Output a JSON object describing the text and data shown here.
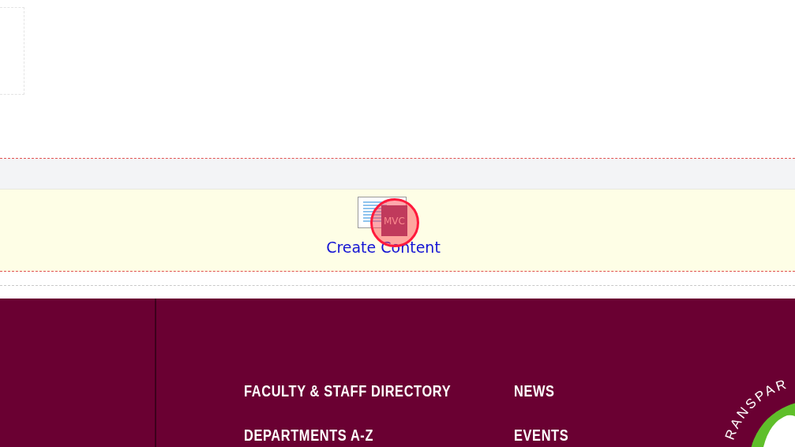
{
  "widget": {
    "badge": "MVC",
    "link": "Create Content"
  },
  "footer": {
    "links": [
      {
        "label": "FACULTY & STAFF DIRECTORY"
      },
      {
        "label": "NEWS"
      },
      {
        "label": "DEPARTMENTS A-Z"
      },
      {
        "label": "EVENTS"
      }
    ],
    "logo_text": "RANSPAR"
  }
}
